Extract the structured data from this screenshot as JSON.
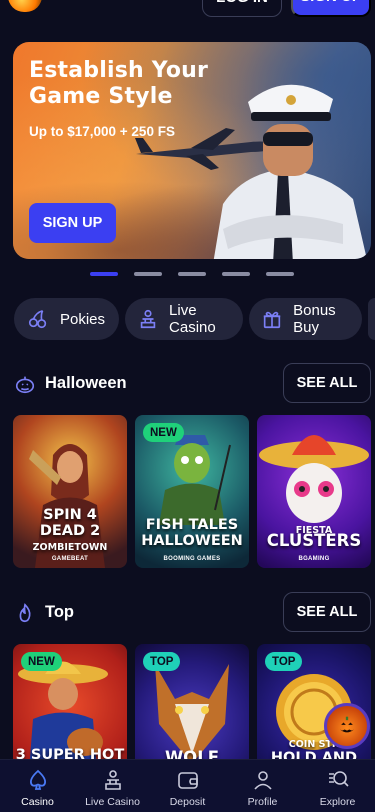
{
  "header": {
    "login_label": "LOG IN",
    "signup_label": "SIGN UP"
  },
  "hero": {
    "title": "Establish Your Game Style",
    "subtitle": "Up to $17,000 + 250 FS",
    "cta": "SIGN UP",
    "slides_total": 5,
    "active_slide": 1
  },
  "categories": [
    {
      "label": "Pokies",
      "icon": "cherries-icon"
    },
    {
      "label": "Live Casino",
      "icon": "dealer-icon"
    },
    {
      "label": "Bonus Buy",
      "icon": "gift-icon"
    }
  ],
  "sections": {
    "halloween": {
      "title": "Halloween",
      "see_all": "SEE ALL",
      "games": [
        {
          "title_line1": "SPIN 4",
          "title_line2": "DEAD 2",
          "title_line3": "ZOMBIETOWN",
          "provider": "GAMEBEAT",
          "badge": ""
        },
        {
          "title_line1": "FISH TALES",
          "title_line2": "HALLOWEEN",
          "provider": "BOOMING GAMES",
          "badge": "NEW"
        },
        {
          "title_line1": "FIESTA",
          "title_line2": "CLUSTERS",
          "provider": "BGAMING",
          "badge": ""
        }
      ]
    },
    "top": {
      "title": "Top",
      "see_all": "SEE ALL",
      "games": [
        {
          "title_line1": "3 SUPER HOT",
          "badge": "NEW"
        },
        {
          "title_line1": "WOLF",
          "badge": "TOP"
        },
        {
          "title_line1": "COIN STR",
          "title_line2": "HOLD AND",
          "badge": "TOP"
        }
      ]
    }
  },
  "bottom_nav": [
    {
      "label": "Casino",
      "icon": "spade-icon",
      "active": true
    },
    {
      "label": "Live Casino",
      "icon": "dealer-icon",
      "active": false
    },
    {
      "label": "Deposit",
      "icon": "wallet-icon",
      "active": false
    },
    {
      "label": "Profile",
      "icon": "user-icon",
      "active": false
    },
    {
      "label": "Explore",
      "icon": "search-icon",
      "active": false
    }
  ],
  "colors": {
    "background": "#0c0d1f",
    "accent": "#3b3ff2",
    "chip_bg": "#23253b",
    "badge_new": "#1fd17a",
    "badge_top": "#1fd1b8"
  }
}
